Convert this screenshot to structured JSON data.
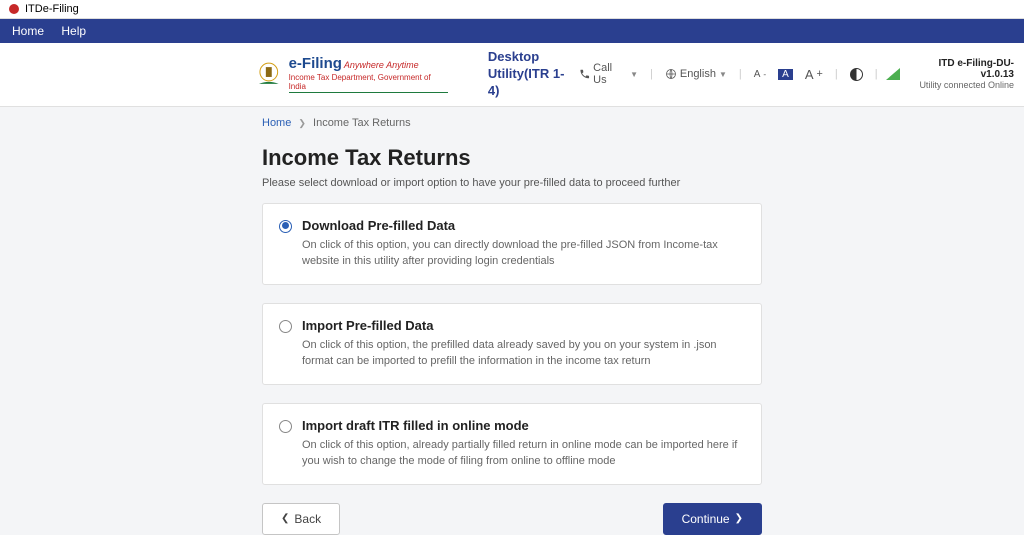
{
  "titlebar": {
    "app_name": "ITDe-Filing"
  },
  "menubar": {
    "home": "Home",
    "help": "Help"
  },
  "header": {
    "logo_main": "e-Filing",
    "logo_tag": "Anywhere Anytime",
    "logo_sub": "Income Tax Department, Government of India",
    "app_title_l1": "Desktop",
    "app_title_l2": "Utility(ITR 1-4)",
    "call_us": "Call Us",
    "language": "English",
    "version": "ITD e-Filing-DU-v1.0.13",
    "conn_status": "Utility connected Online"
  },
  "breadcrumb": {
    "home": "Home",
    "current": "Income Tax Returns"
  },
  "page": {
    "title": "Income Tax Returns",
    "subtitle": "Please select download or import option to have your pre-filled data to proceed further"
  },
  "options": [
    {
      "title": "Download Pre-filled Data",
      "desc": "On click of this option, you can directly download the pre-filled JSON from Income-tax website in this utility after providing login credentials"
    },
    {
      "title": "Import Pre-filled Data",
      "desc": "On click of this option, the prefilled data already saved by you on your system in .json format can be imported to prefill the information in the income tax return"
    },
    {
      "title": "Import draft ITR filled in online mode",
      "desc": "On click of this option, already partially filled return in online mode can be imported here if you wish to change the mode of filing from online to offline mode"
    }
  ],
  "buttons": {
    "back": "Back",
    "continue": "Continue"
  }
}
